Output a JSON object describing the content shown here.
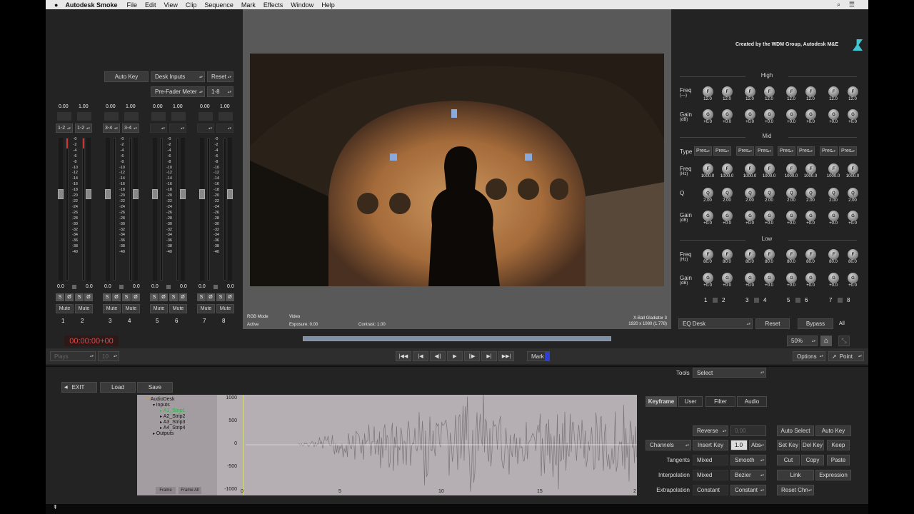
{
  "menu": {
    "app": "Autodesk Smoke",
    "items": [
      "File",
      "Edit",
      "View",
      "Clip",
      "Sequence",
      "Mark",
      "Effects",
      "Window",
      "Help"
    ]
  },
  "credit": "Created by the WDM Group, Autodesk M&E",
  "mixer": {
    "auto_key": "Auto Key",
    "desk_inputs": "Desk Inputs",
    "reset": "Reset",
    "pre_fader": "Pre-Fader Meter",
    "range": "1-8",
    "gains": [
      "0.00",
      "1.00",
      "0.00",
      "1.00",
      "0.00",
      "1.00",
      "0.00",
      "1.00"
    ],
    "pairs": [
      "1-2",
      "1-2",
      "3-4",
      "3-4"
    ],
    "scale": [
      "-0",
      "-2",
      "-4",
      "-6",
      "-8",
      "-10",
      "-12",
      "-14",
      "-16",
      "-18",
      "-20",
      "-22",
      "-24",
      "-26",
      "-28",
      "-30",
      "-32",
      "-34",
      "-36",
      "-38",
      "-40"
    ],
    "bottom_vals": [
      "0.0",
      "0.0",
      "0.0",
      "0.0",
      "0.0",
      "0.0",
      "0.0",
      "0.0"
    ],
    "s": "S",
    "phase": "Ø",
    "mute": "Mute",
    "channels": [
      "1",
      "2",
      "3",
      "4",
      "5",
      "6",
      "7",
      "8"
    ],
    "timecode": "00:00:00+00"
  },
  "viewer": {
    "rgb_mode": "RGB Mode",
    "active": "Active",
    "video": "Video",
    "exposure": "Exposure: 0.00",
    "contrast": "Contrast: 1.00",
    "clip_name": "X-Ball Gladiator 3",
    "resolution": "1920 x 1080 (1.778)"
  },
  "eq": {
    "high": "High",
    "mid": "Mid",
    "low": "Low",
    "freq": "Freq",
    "freq_unit_high": "(---)",
    "hz": "(Hz)",
    "gain": "Gain",
    "db": "(dB)",
    "type": "Type",
    "q": "Q",
    "high_freq": "12.0",
    "gain_val": "+0.0",
    "mid_freq": "1000.0",
    "q_val": "2.00",
    "low_freq": "80.0",
    "pres": "Pres",
    "k_f": "F",
    "k_g": "G",
    "k_q": "Q",
    "eq_desk": "EQ Desk",
    "reset": "Reset",
    "bypass": "Bypass",
    "all": "All",
    "zoom": "50%"
  },
  "transport": {
    "mark": "Mark",
    "options": "Options",
    "point": "Point",
    "plays": "Plays",
    "frame_sel": "10"
  },
  "editor": {
    "tools_label": "Tools",
    "tools_value": "Select",
    "exit": "EXIT",
    "load": "Load",
    "save": "Save",
    "tree": [
      "AudioDesk",
      "Inputs",
      "A1_Strip1",
      "A2_Strip2",
      "A3_Strip3",
      "A4_Strip4",
      "Outputs"
    ],
    "y_ticks": [
      "1000",
      "500",
      "0",
      "-500",
      "-1000"
    ],
    "x_ticks": [
      "0",
      "5",
      "10",
      "15",
      "2"
    ],
    "frame": "Frame",
    "frame_all": "Frame All",
    "tabs": [
      "Keyframe",
      "User",
      "Filter",
      "Audio"
    ],
    "reverse": "Reverse",
    "reverse_val": "0.00",
    "channels": "Channels",
    "insert_key": "Insert Key",
    "step": "1.0",
    "abs": "Abs",
    "tangents": "Tangents",
    "tangents_val": "Mixed",
    "smooth": "Smooth",
    "interpolation": "Interpolation",
    "interp_val": "Mixed",
    "bezier": "Bezier",
    "extrapolation": "Extrapolation",
    "extrap_val": "Constant",
    "extrap_sel": "Constant",
    "auto_select": "Auto Select",
    "auto_key": "Auto Key",
    "set_key": "Set Key",
    "del_key": "Del Key",
    "keep": "Keep",
    "cut": "Cut",
    "copy": "Copy",
    "paste": "Paste",
    "link": "Link",
    "expression": "Expression",
    "reset_chn": "Reset Chn"
  }
}
